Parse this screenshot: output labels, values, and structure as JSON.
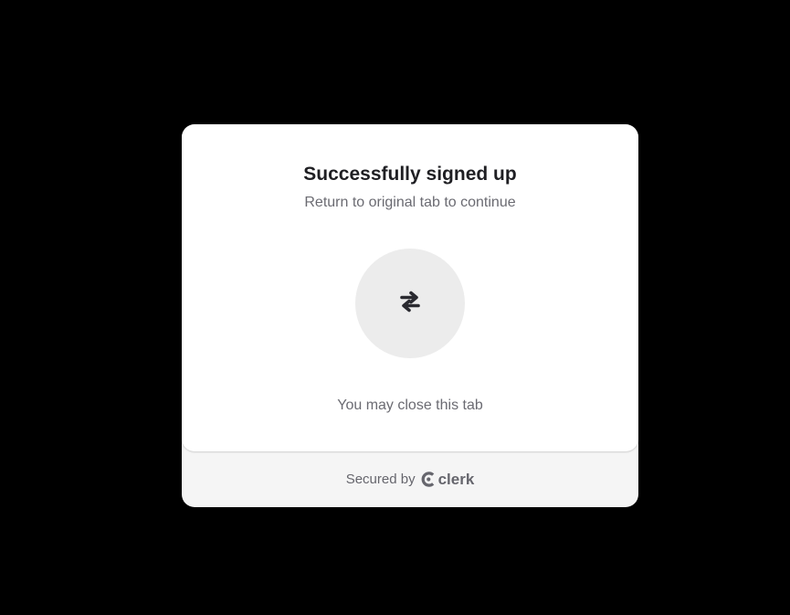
{
  "card": {
    "title": "Successfully signed up",
    "subtitle": "Return to original tab to continue",
    "icon": "switch-arrows-icon",
    "message": "You may close this tab"
  },
  "footer": {
    "secured_by": "Secured by",
    "brand_name": "clerk",
    "brand_icon": "clerk-logo-icon"
  },
  "colors": {
    "page_background": "#000000",
    "card_background": "#ffffff",
    "footer_background": "#f5f5f5",
    "icon_circle": "#ececec",
    "title_text": "#1f1f23",
    "muted_text": "#6b6b72"
  }
}
